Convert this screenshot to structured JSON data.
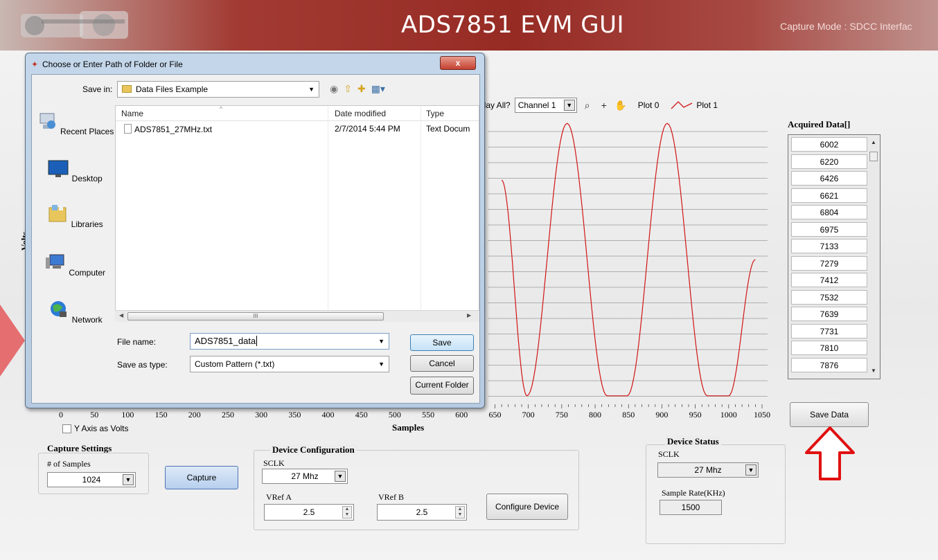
{
  "header": {
    "title": "ADS7851 EVM GUI",
    "capture_mode": "Capture Mode : SDCC Interfac"
  },
  "plot": {
    "display_all_label": "play All?",
    "channel_selected": "Channel 1",
    "legend": [
      "Plot 0",
      "Plot 1"
    ],
    "y_axis_title": "Volts",
    "x_axis_title": "Samples",
    "x_ticks": [
      "0",
      "50",
      "100",
      "150",
      "200",
      "250",
      "300",
      "350",
      "400",
      "450",
      "500",
      "550",
      "600",
      "650",
      "700",
      "750",
      "800",
      "850",
      "900",
      "950",
      "1000",
      "1050"
    ],
    "y_axis_as_volts_label": "Y Axis as Volts",
    "colors": {
      "plot1": "#d21414",
      "grid": "#9a9a9a"
    }
  },
  "chart_data": {
    "type": "line",
    "xlabel": "Samples",
    "ylabel": "Volts",
    "xlim": [
      0,
      1050
    ],
    "legend": "top",
    "series": [
      {
        "name": "Plot 1",
        "x": [
          660,
          698,
          758,
          818,
          848,
          908,
          968,
          1000,
          1040
        ],
        "y": [
          0.78,
          0.02,
          0.98,
          0.02,
          0.02,
          0.98,
          0.02,
          0.02,
          0.5
        ]
      }
    ]
  },
  "acquired": {
    "title": "Acquired Data[]",
    "values": [
      "6002",
      "6220",
      "6426",
      "6621",
      "6804",
      "6975",
      "7133",
      "7279",
      "7412",
      "7532",
      "7639",
      "7731",
      "7810",
      "7876"
    ],
    "save_button": "Save Data"
  },
  "capture": {
    "title": "Capture Settings",
    "samples_label": "# of Samples",
    "samples_value": "1024",
    "capture_button": "Capture"
  },
  "device_config": {
    "title": "Device Configuration",
    "sclk_label": "SCLK",
    "sclk_value": "27 Mhz",
    "vref_a_label": "VRef  A",
    "vref_a_value": "2.5",
    "vref_b_label": "VRef  B",
    "vref_b_value": "2.5",
    "configure_button": "Configure Device"
  },
  "device_status": {
    "title": "Device Status",
    "sclk_label": "SCLK",
    "sclk_value": "27 Mhz",
    "sample_rate_label": "Sample Rate(KHz)",
    "sample_rate_value": "1500"
  },
  "dialog": {
    "title": "Choose or Enter Path of Folder or File",
    "close": "x",
    "save_in_label": "Save in:",
    "save_in_value": "Data Files Example",
    "places": [
      "Recent Places",
      "Desktop",
      "Libraries",
      "Computer",
      "Network"
    ],
    "columns": [
      "Name",
      "Date modified",
      "Type"
    ],
    "files": [
      {
        "name": "ADS7851_27MHz.txt",
        "date": "2/7/2014 5:44 PM",
        "type": "Text Docum"
      }
    ],
    "scroll_grip": "III",
    "file_name_label": "File name:",
    "file_name_value": "ADS7851_data",
    "save_type_label": "Save as type:",
    "save_type_value": "Custom Pattern (*.txt)",
    "save_button": "Save",
    "cancel_button": "Cancel",
    "current_folder_button": "Current Folder"
  }
}
